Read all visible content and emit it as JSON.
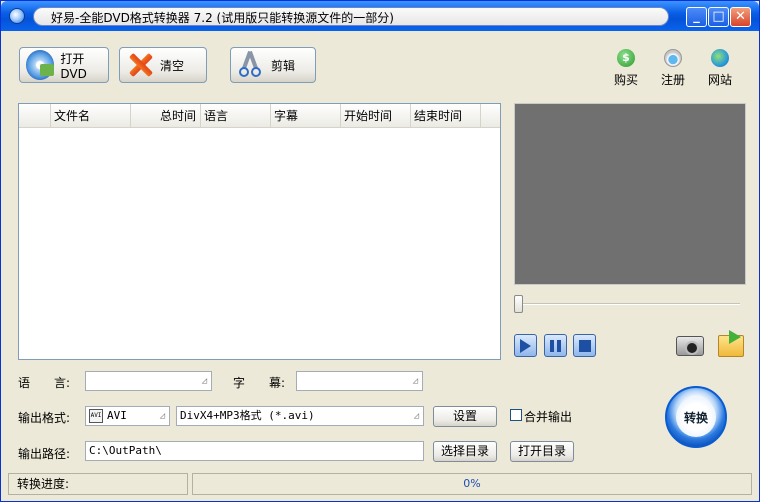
{
  "window": {
    "title": "好易-全能DVD格式转换器 7.2 (试用版只能转换源文件的一部分)",
    "controls": {
      "minimize": "_",
      "maximize": "□",
      "close": "✕"
    }
  },
  "toolbar": {
    "open_dvd_label": "打开DVD",
    "clear_label": "清空",
    "clip_label": "剪辑"
  },
  "links": {
    "buy_label": "购买",
    "buy_glyph": "$",
    "register_label": "注册",
    "website_label": "网站"
  },
  "filelist": {
    "columns": [
      "",
      "文件名",
      "总时间",
      "语言",
      "字幕",
      "开始时间",
      "结束时间"
    ]
  },
  "form": {
    "language_label": "语　　言:",
    "subtitle_label": "字　　幕:",
    "output_format_label": "输出格式:",
    "output_format_type": "AVI",
    "output_format_type_badge": "AVI",
    "output_format_detail": "DivX4+MP3格式 (*.avi)",
    "settings_button": "设置",
    "merge_output_label": "合并输出",
    "output_path_label": "输出路径:",
    "output_path_value": "C:\\OutPath\\",
    "choose_dir_button": "选择目录",
    "open_dir_button": "打开目录",
    "combo_arrow": "◿"
  },
  "convert": {
    "label": "转换"
  },
  "status": {
    "progress_label": "转换进度:",
    "progress_value": 0,
    "progress_text": "0%"
  }
}
